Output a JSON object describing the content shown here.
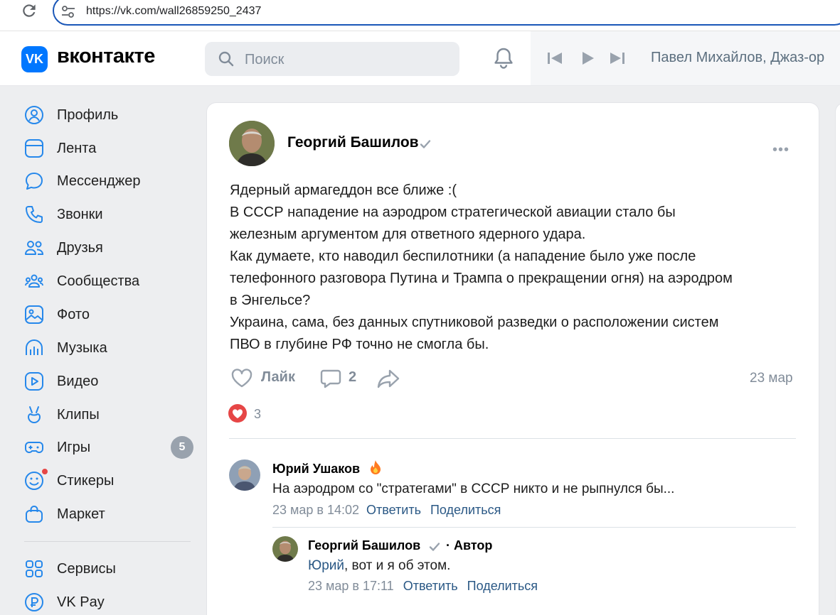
{
  "browser": {
    "url": "https://vk.com/wall26859250_2437"
  },
  "header": {
    "logo_text": "VK",
    "brand": "вконтакте",
    "search_placeholder": "Поиск",
    "player_track": "Павел Михайлов, Джаз-ор"
  },
  "sidebar": {
    "items": [
      {
        "label": "Профиль",
        "icon": "profile-icon"
      },
      {
        "label": "Лента",
        "icon": "feed-icon"
      },
      {
        "label": "Мессенджер",
        "icon": "messenger-icon"
      },
      {
        "label": "Звонки",
        "icon": "phone-icon"
      },
      {
        "label": "Друзья",
        "icon": "friends-icon"
      },
      {
        "label": "Сообщества",
        "icon": "communities-icon"
      },
      {
        "label": "Фото",
        "icon": "photo-icon"
      },
      {
        "label": "Музыка",
        "icon": "music-icon"
      },
      {
        "label": "Видео",
        "icon": "video-icon"
      },
      {
        "label": "Клипы",
        "icon": "clips-icon"
      },
      {
        "label": "Игры",
        "icon": "games-icon",
        "badge": "5"
      },
      {
        "label": "Стикеры",
        "icon": "stickers-icon"
      },
      {
        "label": "Маркет",
        "icon": "market-icon"
      },
      {
        "label": "Сервисы",
        "icon": "services-icon"
      },
      {
        "label": "VK Pay",
        "icon": "vkpay-icon"
      }
    ]
  },
  "post": {
    "author": "Георгий Башилов",
    "lines": [
      "Ядерный армагеддон все ближе :(",
      "В СССР нападение на аэродром стратегической авиации стало бы",
      "железным аргументом для ответного ядерного удара.",
      "Как думаете, кто наводил беспилотники (а нападение было уже после",
      "телефонного разговора Путина и Трампа о прекращении огня) на аэродром",
      "в Энгельсе?",
      "Украина, сама, без данных спутниковой разведки о расположении систем",
      "ПВО в глубине РФ точно не смогла бы."
    ],
    "like_label": "Лайк",
    "comments_count": "2",
    "date": "23 мар",
    "reactions_count": "3"
  },
  "comments": [
    {
      "author": "Юрий Ушаков",
      "text": "На аэродром со \"стратегами\" в СССР никто и не рыпнулся бы...",
      "date": "23 мар в 14:02",
      "reply_label": "Ответить",
      "share_label": "Поделиться"
    },
    {
      "author": "Георгий Башилов",
      "author_tag": "· Автор",
      "mention": "Юрий",
      "text": ", вот и я об этом.",
      "date": "23 мар в 17:11",
      "reply_label": "Ответить",
      "share_label": "Поделиться"
    }
  ],
  "colors": {
    "accent": "#0077ff",
    "link": "#2a5885",
    "like_red": "#e64646",
    "muted": "#818c99"
  }
}
